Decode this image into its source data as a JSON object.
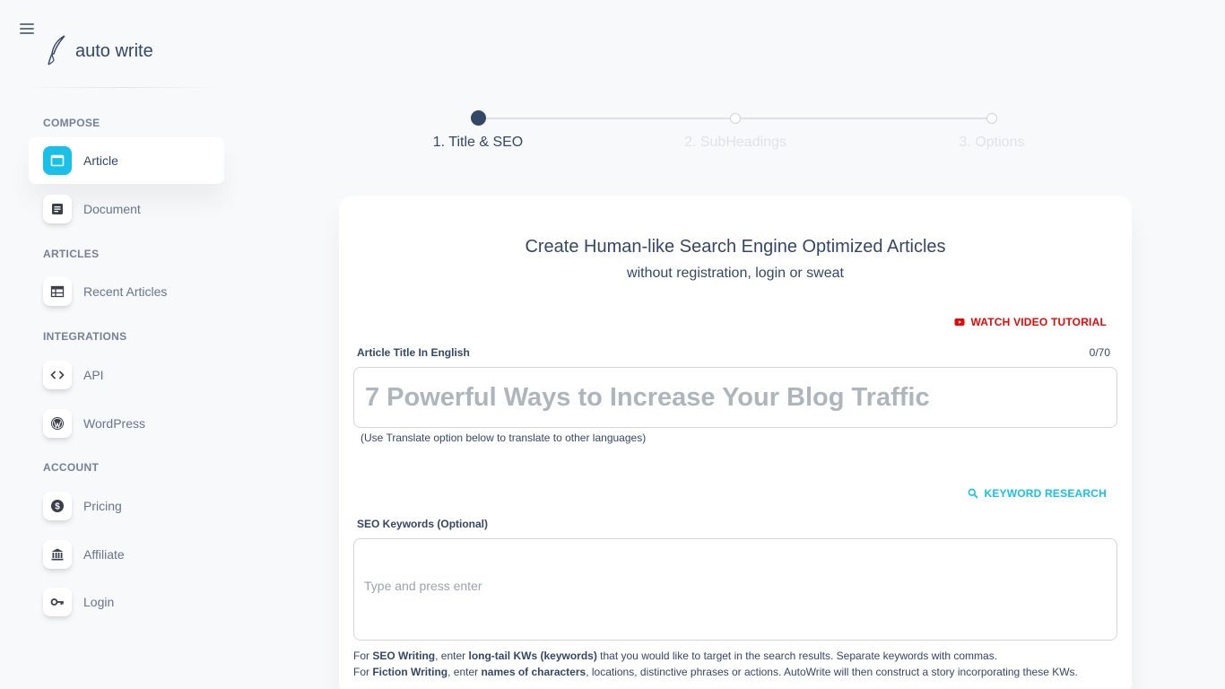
{
  "brand": {
    "name": "auto write"
  },
  "sidebar": {
    "sections": [
      {
        "label": "COMPOSE"
      },
      {
        "label": "ARTICLES"
      },
      {
        "label": "INTEGRATIONS"
      },
      {
        "label": "ACCOUNT"
      }
    ],
    "items": [
      {
        "label": "Article",
        "icon": "browser-window-icon",
        "active": true
      },
      {
        "label": "Document",
        "icon": "document-icon"
      },
      {
        "label": "Recent Articles",
        "icon": "table-icon"
      },
      {
        "label": "API",
        "icon": "code-icon"
      },
      {
        "label": "WordPress",
        "icon": "wordpress-icon"
      },
      {
        "label": "Pricing",
        "icon": "dollar-icon"
      },
      {
        "label": "Affiliate",
        "icon": "bank-icon"
      },
      {
        "label": "Login",
        "icon": "key-icon"
      }
    ]
  },
  "stepper": {
    "steps": [
      {
        "label": "1. Title & SEO",
        "active": true
      },
      {
        "label": "2. SubHeadings",
        "active": false
      },
      {
        "label": "3. Options",
        "active": false
      }
    ]
  },
  "card": {
    "title": "Create Human-like Search Engine Optimized Articles",
    "subtitle": "without registration, login or sweat",
    "video_tutorial_label": "WATCH VIDEO TUTORIAL",
    "title_field": {
      "label": "Article Title In English",
      "counter": "0/70",
      "value": "",
      "placeholder": "7 Powerful Ways to Increase Your Blog Traffic",
      "hint": "(Use Translate option below to translate to other languages)"
    },
    "keyword_research_label": "KEYWORD RESEARCH",
    "keywords_field": {
      "label": "SEO Keywords (Optional)",
      "placeholder": "Type and press enter"
    },
    "help": {
      "seo_prefix": "For ",
      "seo_term": "SEO Writing",
      "seo_mid": ", enter ",
      "seo_bold": "long-tail KWs (keywords)",
      "seo_suffix": " that you would like to target in the search results. Separate keywords with commas.",
      "fiction_prefix": "For ",
      "fiction_term": "Fiction Writing",
      "fiction_mid": ", enter ",
      "fiction_bold": "names of characters",
      "fiction_suffix": ", locations, distinctive phrases or actions. AutoWrite will then construct a story incorporating these KWs."
    }
  },
  "colors": {
    "accent": "#17c1e8",
    "danger": "#ea0606",
    "text": "#344767",
    "muted": "#67748e"
  }
}
